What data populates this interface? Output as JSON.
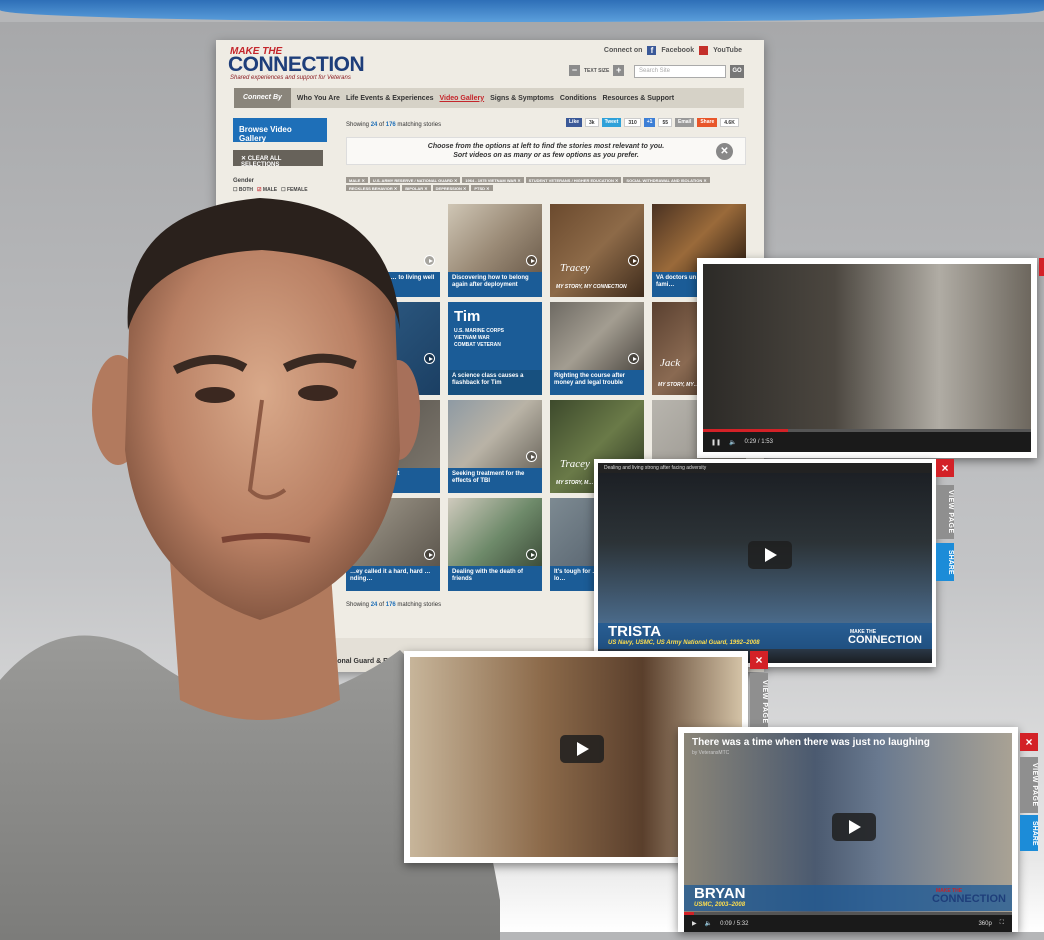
{
  "site": {
    "logo": {
      "line1": "MAKE THE",
      "line2": "CONNECTION",
      "tagline": "Shared experiences and support for Veterans"
    },
    "connect": {
      "label": "Connect on",
      "facebook": "Facebook",
      "youtube": "YouTube"
    },
    "text_size": "TEXT SIZE",
    "search_placeholder": "Search Site",
    "go": "GO",
    "nav": {
      "connect_by": "Connect By",
      "items": [
        "Who You Are",
        "Life Events & Experiences",
        "Video Gallery",
        "Signs & Symptoms",
        "Conditions",
        "Resources & Support"
      ]
    },
    "sidebar": {
      "title": "Browse Video Gallery",
      "clear": "CLEAR ALL SELECTIONS",
      "gender_label": "Gender",
      "gender_options": [
        "BOTH",
        "MALE",
        "FEMALE"
      ]
    },
    "showing": {
      "prefix": "Showing",
      "count": "24",
      "of": "of",
      "total": "176",
      "suffix": "matching stories"
    },
    "share_bar": [
      "Like",
      "3k",
      "Tweet",
      "310",
      "+1",
      "55",
      "Email",
      "Share",
      "4.6K"
    ],
    "choose_text": [
      "Choose from the options at left to find the stories most relevant to you.",
      "Sort videos on as many or as few options as you prefer."
    ],
    "tags": [
      "MALE",
      "U.S. ARMY RESERVE / NATIONAL GUARD",
      "1964 - 1975 VIETNAM WAR",
      "STUDENT VETERANS / HIGHER EDUCATION",
      "SOCIAL WITHDRAWAL AND ISOLATION",
      "RECKLESS BEHAVIOR",
      "BIPOLAR",
      "DEPRESSION",
      "PTSD"
    ],
    "tiles": [
      {
        "caption": "…pt him from … to living well"
      },
      {
        "caption": "Discovering how to belong again after deployment"
      },
      {
        "caption": "MY STORY, MY CONNECTION",
        "name": "Tracey"
      },
      {
        "caption": "VA doctors un… stress my fami…"
      },
      {
        "caption": "…Y CONNECTION"
      },
      {
        "caption": "A science class causes a flashback for Tim"
      },
      {
        "caption": "Righting the course after money and legal trouble"
      },
      {
        "caption": "MY STORY, MY…",
        "name": "Jack"
      },
      {
        "caption": "…may …tirement"
      },
      {
        "caption": "Seeking treatment for the effects of TBI"
      },
      {
        "caption": "MY STORY, M…",
        "name": "Tracey"
      },
      {
        "caption": ""
      },
      {
        "caption": "…ey called it a hard, hard …nding…"
      },
      {
        "caption": "Dealing with the death of friends"
      },
      {
        "caption": "It's tough for … say this out lo…"
      }
    ],
    "tim_tile": {
      "name": "Tim",
      "lines": [
        "U.S. MARINE CORPS",
        "VIETNAM WAR",
        "COMBAT VETERAN"
      ]
    },
    "footer": {
      "nav": "National Guard & Reserve",
      "col": "& Symptoms",
      "sub": "Drug Problems"
    }
  },
  "players": {
    "p1": {
      "time": "0:29 / 1:53"
    },
    "p2": {
      "title": "Dealing and living strong after facing adversity",
      "name": "TRISTA",
      "sub": "US Navy, USMC, US Army National Guard, 1992–2008",
      "logo": "CONNECTION",
      "logo_top": "MAKE THE"
    },
    "p3": {},
    "p4": {
      "title": "There was a time when there was just no laughing",
      "by": "by VeteransMTC",
      "name": "BRYAN",
      "sub": "USMC, 2003–2008",
      "time": "0:09 / 5:32",
      "quality": "360p",
      "logo": "CONNECTION",
      "logo_top": "MAKE THE"
    },
    "close": "×",
    "view_page": "VIEW PAGE",
    "share": "SHARE"
  },
  "progress": {
    "p1": 0.26,
    "p4": 0.03
  },
  "colors": {
    "brand_blue": "#1e6fb8",
    "brand_red": "#c4252b",
    "close_red": "#d32127",
    "share_blue": "#1c8cd8"
  }
}
